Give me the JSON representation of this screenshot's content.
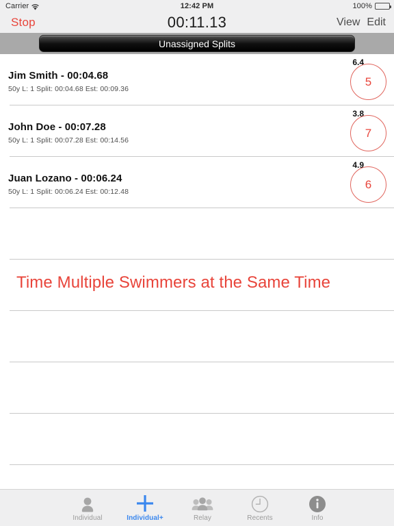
{
  "statusbar": {
    "carrier": "Carrier",
    "wifi_icon": "wifi-icon",
    "time": "12:42 PM",
    "battery_percent": "100%",
    "battery_icon": "battery-full-icon"
  },
  "navbar": {
    "stop_label": "Stop",
    "timer": "00:11.13",
    "view_label": "View",
    "edit_label": "Edit"
  },
  "segment": {
    "button_label": "Unassigned Splits"
  },
  "list": {
    "rows": [
      {
        "name": "Jim Smith - 00:04.68",
        "detail": "50y L: 1  Split: 00:04.68  Est: 00:09.36",
        "metric": "6.4",
        "badge": "5"
      },
      {
        "name": "John Doe - 00:07.28",
        "detail": "50y L: 1  Split: 00:07.28  Est: 00:14.56",
        "metric": "3.8",
        "badge": "7"
      },
      {
        "name": "Juan Lozano - 00:06.24",
        "detail": "50y L: 1  Split: 00:06.24  Est: 00:12.48",
        "metric": "4.9",
        "badge": "6"
      }
    ],
    "promo_text": "Time Multiple Swimmers at the Same Time"
  },
  "tabbar": {
    "items": [
      {
        "label": "Individual",
        "icon": "person-icon",
        "active": false
      },
      {
        "label": "Individual+",
        "icon": "plus-icon",
        "active": true
      },
      {
        "label": "Relay",
        "icon": "people-group-icon",
        "active": false
      },
      {
        "label": "Recents",
        "icon": "clock-icon",
        "active": false
      },
      {
        "label": "Info",
        "icon": "info-circle-icon",
        "active": false
      }
    ]
  },
  "colors": {
    "accent_red": "#e8443a",
    "accent_blue": "#3a87ee",
    "chrome_gray": "#efeff0",
    "band_gray": "#a9a9a9"
  }
}
